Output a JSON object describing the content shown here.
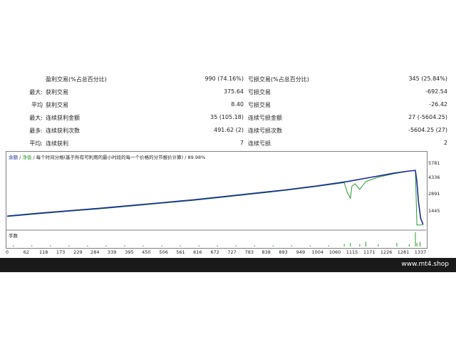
{
  "stats": {
    "rows": [
      {
        "prefix": "",
        "label1": "盈利交易(%占总百分比)",
        "value1": "990 (74.16%)",
        "label2": "亏损交易(%占总百分比)",
        "value2": "345 (25.84%)"
      },
      {
        "prefix": "最大:",
        "label1": "获利交易",
        "value1": "375.64",
        "label2": "亏损交易",
        "value2": "-692.54"
      },
      {
        "prefix": "平均",
        "label1": "获利交易",
        "value1": "8.40",
        "label2": "亏损交易",
        "value2": "-26.42"
      },
      {
        "prefix": "最大:",
        "label1": "连续获利金额",
        "value1": "35 (105.18)",
        "label2": "连续亏损金额",
        "value2": "27 (-5604.25)"
      },
      {
        "prefix": "最多:",
        "label1": "连续获利次数",
        "value1": "491.62 (2)",
        "label2": "连续亏损次数",
        "value2": "-5604.25 (27)"
      },
      {
        "prefix": "平均:",
        "label1": "连续获利",
        "value1": "7",
        "label2": "连续亏损",
        "value2": "2"
      }
    ]
  },
  "chart": {
    "legend": {
      "balance": "余额",
      "sep": " / ",
      "equity": "净值",
      "rest": " / 每个时间分格(基于所有可利用的最小时段的每一个价格的分节报价计算) / 89.98%"
    },
    "lots_label": "手数",
    "colors": {
      "balance": "#1a2b9c",
      "equity": "#2a9a2a",
      "lots": "#2a9a2a",
      "grid": "#808080"
    }
  },
  "footer": {
    "site": "www.mt4.shop"
  },
  "chart_data": {
    "type": "line",
    "title": "",
    "xlabel": "",
    "ylabel": "",
    "x_ticks": [
      "0",
      "62",
      "118",
      "173",
      "229",
      "284",
      "339",
      "395",
      "450",
      "506",
      "561",
      "616",
      "672",
      "727",
      "783",
      "838",
      "893",
      "949",
      "1004",
      "1060",
      "1115",
      "1171",
      "1226",
      "1281",
      "1337"
    ],
    "y_ticks": [
      "5781",
      "4336",
      "2891",
      "1445"
    ],
    "xlim": [
      0,
      1350
    ],
    "ylim": [
      0,
      6400
    ],
    "series": [
      {
        "name": "余额",
        "x": [
          0,
          100,
          200,
          300,
          400,
          500,
          600,
          700,
          800,
          900,
          1000,
          1050,
          1100,
          1150,
          1200,
          1250,
          1300,
          1320,
          1325,
          1330,
          1337,
          1345
        ],
        "y": [
          1200,
          1450,
          1680,
          1900,
          2150,
          2400,
          2650,
          2950,
          3250,
          3550,
          3900,
          4100,
          4300,
          4550,
          4800,
          5050,
          5250,
          5300,
          4300,
          2500,
          1000,
          450
        ]
      },
      {
        "name": "净值",
        "x": [
          0,
          100,
          200,
          300,
          400,
          500,
          600,
          700,
          800,
          900,
          1000,
          1090,
          1100,
          1110,
          1115,
          1125,
          1140,
          1160,
          1200,
          1250,
          1300,
          1320,
          1325,
          1337,
          1345
        ],
        "y": [
          1150,
          1400,
          1630,
          1850,
          2100,
          2350,
          2600,
          2900,
          3200,
          3500,
          3850,
          4200,
          3300,
          2800,
          3900,
          4100,
          3600,
          4300,
          4700,
          5000,
          5250,
          5300,
          400,
          400,
          450
        ]
      }
    ],
    "lots": {
      "x": [
        20,
        80,
        140,
        200,
        260,
        320,
        380,
        440,
        500,
        560,
        620,
        680,
        740,
        800,
        860,
        920,
        980,
        1040,
        1090,
        1110,
        1140,
        1160,
        1200,
        1260,
        1300,
        1320,
        1325,
        1335
      ],
      "y": [
        1,
        1,
        1,
        1,
        1,
        1,
        1,
        1,
        1,
        1,
        1,
        1,
        1,
        1,
        1,
        1,
        1,
        1,
        2,
        3,
        2,
        4,
        2,
        3,
        2,
        12,
        3,
        4
      ]
    }
  }
}
